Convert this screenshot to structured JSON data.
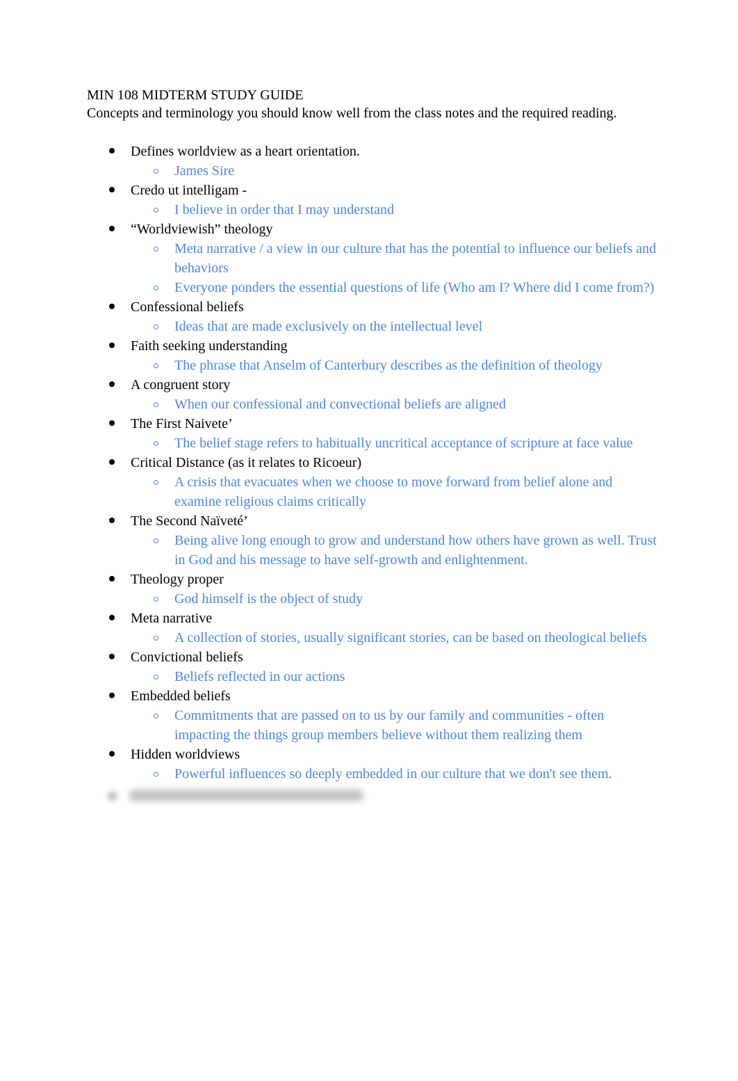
{
  "document": {
    "title": "MIN 108 MIDTERM STUDY GUIDE",
    "subtitle": "Concepts and terminology you should know well from the class notes and the required reading.",
    "colors": {
      "term_text": "#000000",
      "definition_text": "#4a86e8"
    },
    "terms": [
      {
        "term": "Defines worldview as a heart orientation.",
        "definitions": [
          "James Sire"
        ]
      },
      {
        "term": "Credo ut intelligam -",
        "definitions": [
          "I believe in order that I may understand"
        ]
      },
      {
        "term": "“Worldviewish” theology",
        "definitions": [
          "Meta narrative / a view in our culture that has the potential to influence our beliefs and behaviors",
          "Everyone ponders the essential questions of life (Who am I? Where did I come from?)"
        ]
      },
      {
        "term": "Confessional beliefs",
        "definitions": [
          "Ideas that are made exclusively on the intellectual level"
        ]
      },
      {
        "term": "Faith seeking understanding",
        "definitions": [
          "The phrase that Anselm of Canterbury describes as the definition of theology"
        ]
      },
      {
        "term": "A congruent story",
        "definitions": [
          "When our confessional and convectional beliefs are aligned"
        ]
      },
      {
        "term": "The First Naivete’",
        "definitions": [
          "The belief stage refers to habitually uncritical acceptance of scripture at face value"
        ]
      },
      {
        "term": "Critical Distance (as it relates to Ricoeur)",
        "definitions": [
          "A crisis that evacuates when we choose to move forward from belief alone and examine religious claims critically"
        ]
      },
      {
        "term": "The Second Naïveté’",
        "definitions": [
          "Being alive long enough to grow and understand how others have grown as well. Trust in God and his message to have self-growth and enlightenment."
        ]
      },
      {
        "term": "Theology proper",
        "definitions": [
          "God himself is the object of study"
        ]
      },
      {
        "term": "Meta narrative",
        "definitions": [
          "A collection of stories, usually significant stories, can be based on theological beliefs"
        ]
      },
      {
        "term": "Convictional beliefs",
        "definitions": [
          "Beliefs reflected in our actions"
        ]
      },
      {
        "term": "Embedded beliefs",
        "definitions": [
          "Commitments that are passed on to us by our family and communities - often impacting the things group members believe without them realizing them"
        ]
      },
      {
        "term": "Hidden worldviews",
        "definitions": [
          "Powerful influences so deeply embedded in our culture that we don't see them."
        ]
      }
    ],
    "blurred_item": {
      "state": "obscured"
    }
  }
}
